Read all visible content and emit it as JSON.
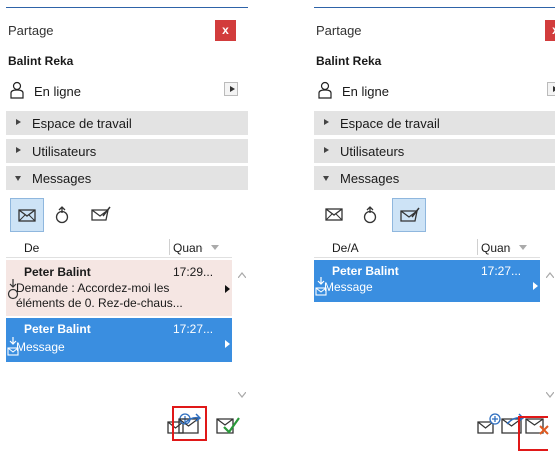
{
  "panels": [
    {
      "title": "Partage",
      "close_label": "x",
      "user": "Balint Reka",
      "status": "En ligne",
      "sections": [
        "Espace de travail",
        "Utilisateurs",
        "Messages"
      ],
      "toolbar_active": "inbox",
      "columns": [
        "De",
        "Quand"
      ],
      "messages": [
        {
          "sender": "Peter Balint",
          "time": "17:29...",
          "body": "Demande : Accordez-moi les éléments de 0. Rez-de-chaus...",
          "kind": "request"
        },
        {
          "sender": "Peter Balint",
          "time": "17:27...",
          "body": "Message",
          "kind": "message",
          "selected": true
        }
      ],
      "highlighted_action": "reply-icon"
    },
    {
      "title": "Partage",
      "close_label": "x",
      "user": "Balint Reka",
      "status": "En ligne",
      "sections": [
        "Espace de travail",
        "Utilisateurs",
        "Messages"
      ],
      "toolbar_active": "sent",
      "columns": [
        "De/A",
        "Quand"
      ],
      "messages": [
        {
          "sender": "Peter Balint",
          "time": "17:27...",
          "body": "Message",
          "kind": "message",
          "selected": true
        }
      ],
      "highlighted_action": "delete-message-icon"
    }
  ],
  "colors": {
    "accent": "#3a8ee0",
    "close": "#d23c3c",
    "highlight": "#e01818",
    "section_bg": "#e3e3e3",
    "request_bg": "#f5e6e3"
  }
}
